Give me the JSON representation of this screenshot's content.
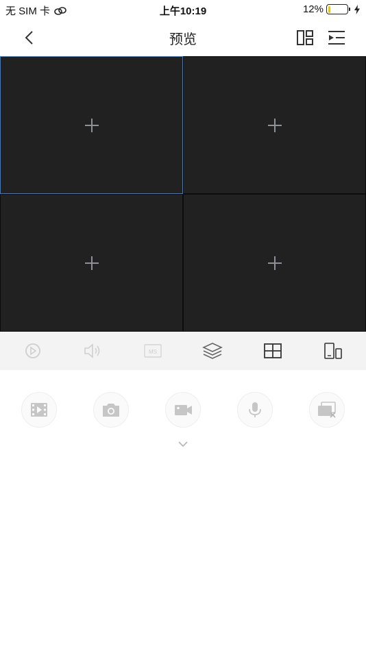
{
  "status_bar": {
    "carrier": "无 SIM 卡",
    "time": "上午10:19",
    "battery_percent": "12%",
    "battery_level": 0.12,
    "battery_color": "#f5c400"
  },
  "nav": {
    "title": "预览",
    "back_icon": "chevron-left-icon",
    "layout_icon": "split-layout-icon",
    "list_icon": "play-list-icon"
  },
  "grid": {
    "channels": [
      {
        "state": "empty",
        "selected": true,
        "icon": "plus-icon"
      },
      {
        "state": "empty",
        "selected": false,
        "icon": "plus-icon"
      },
      {
        "state": "empty",
        "selected": false,
        "icon": "plus-icon"
      },
      {
        "state": "empty",
        "selected": false,
        "icon": "plus-icon"
      }
    ],
    "selected_border_color": "#2f7fe0"
  },
  "toolbar": {
    "items": [
      {
        "icon": "play-icon",
        "enabled": false
      },
      {
        "icon": "speaker-icon",
        "enabled": false
      },
      {
        "icon": "quality-badge-icon",
        "label": "MS",
        "enabled": false
      },
      {
        "icon": "layers-icon",
        "enabled": true
      },
      {
        "icon": "grid-4-icon",
        "enabled": true
      },
      {
        "icon": "device-switch-icon",
        "enabled": true
      }
    ]
  },
  "actions": {
    "items": [
      {
        "icon": "video-playback-icon"
      },
      {
        "icon": "camera-snapshot-icon"
      },
      {
        "icon": "video-record-icon"
      },
      {
        "icon": "microphone-icon"
      },
      {
        "icon": "close-all-windows-icon"
      }
    ],
    "collapse_icon": "chevron-down-icon"
  }
}
